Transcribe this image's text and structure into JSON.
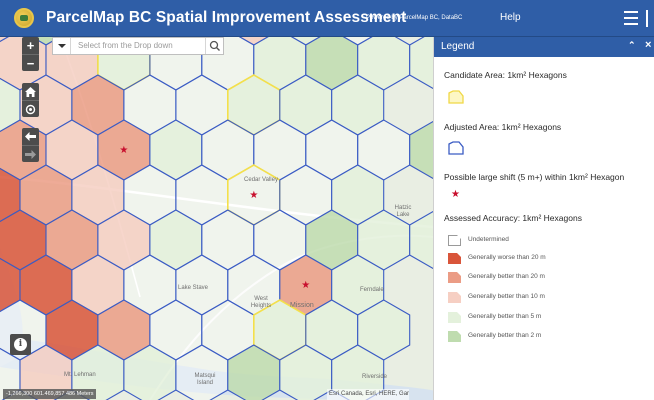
{
  "app": {
    "title": "ParcelMap BC Spatial Improvement Assessment",
    "powered_by": "Powered by ParcelMap BC, DataBC",
    "help": "Help"
  },
  "search": {
    "placeholder": "Select from the Drop down"
  },
  "controls": {
    "zoom_in": "+",
    "zoom_out": "−",
    "info": "i",
    "home_icon": "home-icon",
    "locate_icon": "locate-icon",
    "back_icon": "arrow-left-icon",
    "forward_icon": "arrow-right-icon"
  },
  "map": {
    "scale_text": "-1,266,300 601.469,857 486 Meters",
    "attribution": "Esri Canada, Esri, HERE, Gar",
    "labels": [
      {
        "id": "lake-stave",
        "text": "Lake Stave"
      },
      {
        "id": "hatzic",
        "text": "Hatzic Lake"
      },
      {
        "id": "cedar-valley",
        "text": "Cedar Valley"
      },
      {
        "id": "westheights",
        "text": "West Heights"
      },
      {
        "id": "mission",
        "text": "Mission"
      },
      {
        "id": "ferndale",
        "text": "Ferndale"
      },
      {
        "id": "matsqui",
        "text": "Matsqui Island"
      },
      {
        "id": "riverside",
        "text": "Riverside"
      },
      {
        "id": "mt-lehman",
        "text": "Mt. Lehman"
      }
    ],
    "colors": {
      "undetermined": "#ffffff",
      "worse_20": "#d9553a",
      "better_20": "#eb9c85",
      "better_10": "#f6cfc3",
      "better_5": "#e4f1dc",
      "better_2": "#bfdcaf",
      "hex_stroke": "#3b5cc4",
      "candidate_stroke": "#f4e04a",
      "star": "#c8102e"
    }
  },
  "legend": {
    "title": "Legend",
    "collapse_icon": "chevron-up-icon",
    "close_icon": "close-icon",
    "candidate_heading": "Candidate Area: 1km² Hexagons",
    "adjusted_heading": "Adjusted Area: 1km² Hexagons",
    "shift_heading": "Possible large shift (5 m+) within 1km² Hexagon",
    "accuracy_heading": "Assessed Accuracy: 1km² Hexagons",
    "accuracy_items": [
      {
        "label": "Undetermined",
        "color": "#ffffff"
      },
      {
        "label": "Generally worse than 20 m",
        "color": "#d9553a"
      },
      {
        "label": "Generally better than 20 m",
        "color": "#eb9c85"
      },
      {
        "label": "Generally better than 10 m",
        "color": "#f6cfc3"
      },
      {
        "label": "Generally better than 5 m",
        "color": "#e4f1dc"
      },
      {
        "label": "Generally better than 2 m",
        "color": "#bfdcaf"
      }
    ]
  }
}
